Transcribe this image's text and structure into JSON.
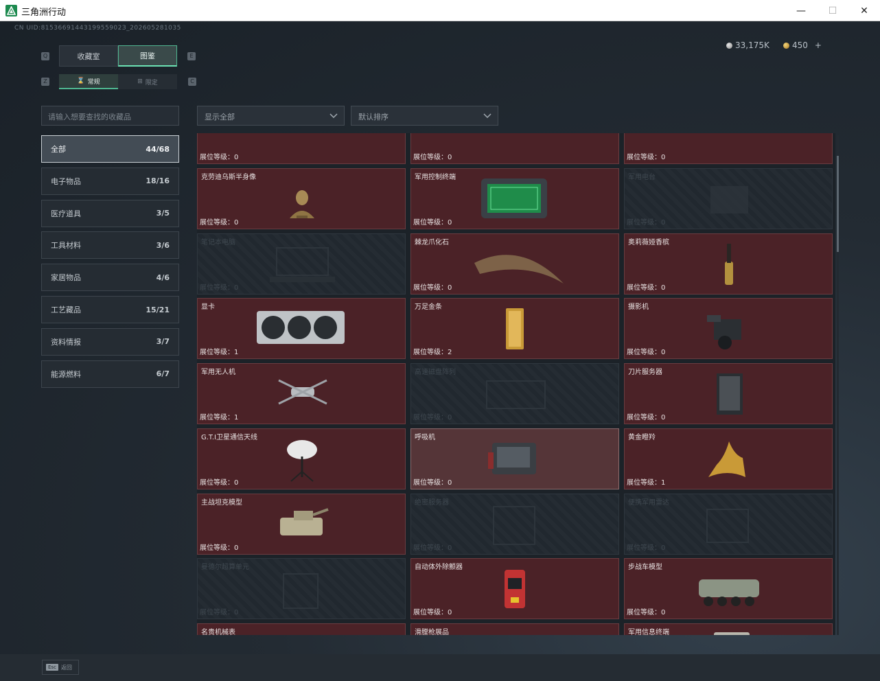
{
  "window": {
    "title": "三角洲行动"
  },
  "uid": "CN UID:8153669144319955902З_202605281035",
  "currency": {
    "silver": "33,175K",
    "gold": "450",
    "gold_add": "+"
  },
  "keys": {
    "q": "Q",
    "e": "E",
    "z": "Z",
    "c": "C"
  },
  "tabs": {
    "collection": "收藏室",
    "atlas": "图鉴"
  },
  "subtabs": {
    "normal": "常规",
    "limited": "限定"
  },
  "search": {
    "placeholder": "请输入想要查找的收藏品"
  },
  "filters": {
    "show": "显示全部",
    "sort": "默认排序"
  },
  "categories": [
    {
      "label": "全部",
      "count": "44/68"
    },
    {
      "label": "电子物品",
      "count": "18/16"
    },
    {
      "label": "医疗道具",
      "count": "3/5"
    },
    {
      "label": "工具材料",
      "count": "3/6"
    },
    {
      "label": "家居物品",
      "count": "4/6"
    },
    {
      "label": "工艺藏品",
      "count": "15/21"
    },
    {
      "label": "资料情报",
      "count": "3/7"
    },
    {
      "label": "能源燃料",
      "count": "6/7"
    }
  ],
  "level_prefix": "展位等级：",
  "top_partial": [
    {
      "level": "展位等级：0"
    },
    {
      "level": "展位等级：0"
    },
    {
      "level": "展位等级：0"
    }
  ],
  "items": [
    {
      "name": "克劳迪乌斯半身像",
      "level": "展位等级：0",
      "state": "owned",
      "icon": "bust-icon"
    },
    {
      "name": "军用控制终端",
      "level": "展位等级：0",
      "state": "owned",
      "icon": "terminal-icon"
    },
    {
      "name": "军用电台",
      "level": "展位等级：0",
      "state": "locked",
      "icon": "radio-icon"
    },
    {
      "name": "笔记本电脑",
      "level": "展位等级：0",
      "state": "locked",
      "icon": "laptop-icon"
    },
    {
      "name": "棘龙爪化石",
      "level": "展位等级：0",
      "state": "owned",
      "icon": "claw-fossil-icon"
    },
    {
      "name": "奥莉薇娅香槟",
      "level": "展位等级：0",
      "state": "owned",
      "icon": "champagne-icon"
    },
    {
      "name": "显卡",
      "level": "展位等级：1",
      "state": "owned",
      "icon": "gpu-icon"
    },
    {
      "name": "万足金条",
      "level": "展位等级：2",
      "state": "owned",
      "icon": "gold-bar-icon"
    },
    {
      "name": "摄影机",
      "level": "展位等级：0",
      "state": "owned",
      "icon": "camera-icon"
    },
    {
      "name": "军用无人机",
      "level": "展位等级：1",
      "state": "owned",
      "icon": "drone-icon"
    },
    {
      "name": "高速磁盘阵列",
      "level": "展位等级：0",
      "state": "locked",
      "icon": "disk-array-icon"
    },
    {
      "name": "刀片服务器",
      "level": "展位等级：0",
      "state": "owned",
      "icon": "server-icon"
    },
    {
      "name": "G.T.I卫星通信天线",
      "level": "展位等级：0",
      "state": "owned",
      "icon": "satellite-dish-icon"
    },
    {
      "name": "呼吸机",
      "level": "展位等级：0",
      "state": "selected",
      "icon": "ventilator-icon"
    },
    {
      "name": "黄金瞪羚",
      "level": "展位等级：1",
      "state": "owned",
      "icon": "gold-gazelle-icon"
    },
    {
      "name": "主战坦克模型",
      "level": "展位等级：0",
      "state": "owned",
      "icon": "tank-icon"
    },
    {
      "name": "绝密服务器",
      "level": "展位等级：0",
      "state": "locked",
      "icon": "server-rack-icon"
    },
    {
      "name": "便携军用雷达",
      "level": "展位等级：0",
      "state": "locked",
      "icon": "radar-icon"
    },
    {
      "name": "曼德尔超算单元",
      "level": "展位等级：0",
      "state": "locked",
      "icon": "supercomputer-icon"
    },
    {
      "name": "自动体外除颤器",
      "level": "展位等级：0",
      "state": "owned",
      "icon": "defibrillator-icon"
    },
    {
      "name": "步战车模型",
      "level": "展位等级：0",
      "state": "owned",
      "icon": "ifv-icon"
    },
    {
      "name": "名贵机械表",
      "level": "",
      "state": "owned",
      "icon": "watch-icon"
    },
    {
      "name": "滑膛枪展品",
      "level": "",
      "state": "owned",
      "icon": "musket-icon"
    },
    {
      "name": "军用信息终端",
      "level": "",
      "state": "owned",
      "icon": "info-terminal-icon"
    }
  ],
  "footer": {
    "esc_key": "Esc",
    "esc_label": "返回"
  }
}
